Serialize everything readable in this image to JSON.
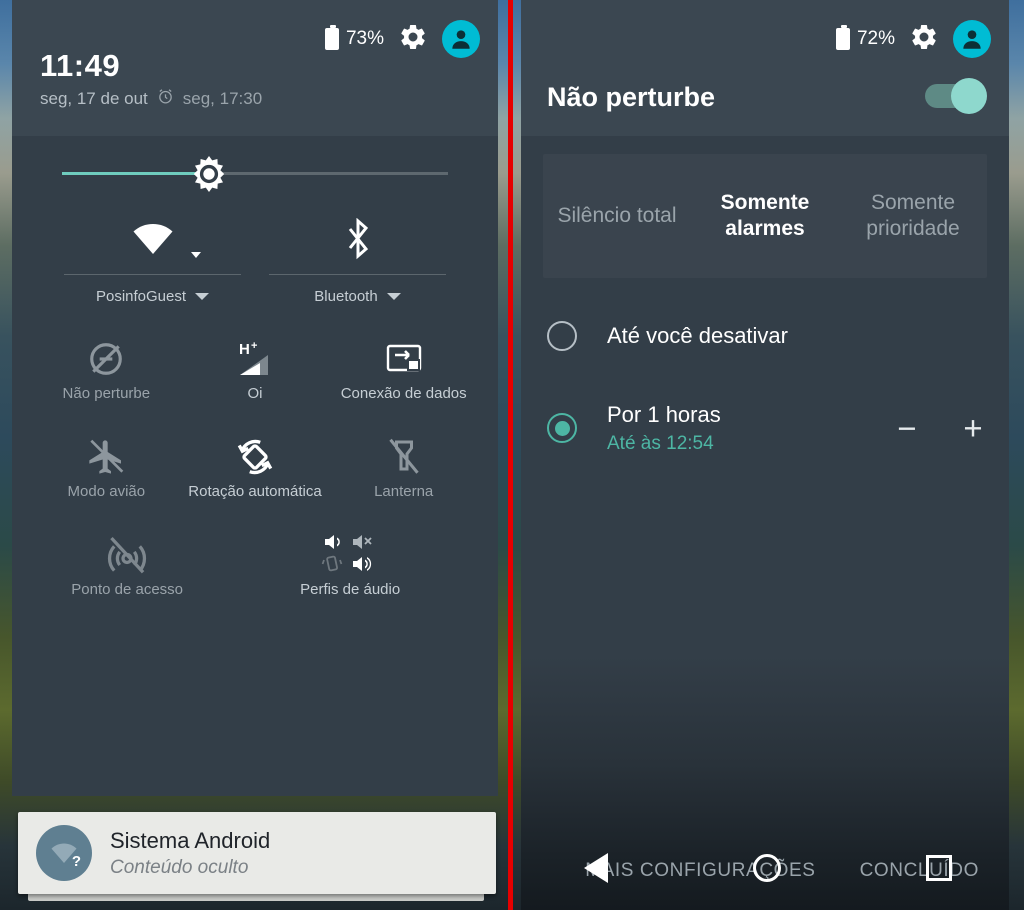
{
  "theme": {
    "panel_bg": "#333e48",
    "header_bg": "#3b4751",
    "accent_teal": "#4db6a4",
    "avatar_cyan": "#00bcd4",
    "divider_red": "#e60000",
    "label_gray": "#c6ced4"
  },
  "left_panel": {
    "status": {
      "battery_percent": "73%",
      "battery_icon": "battery-icon",
      "settings_icon": "gear-icon",
      "avatar_icon": "user-avatar-icon"
    },
    "clock": "11:49",
    "date": "seg, 17 de out",
    "alarm_icon": "alarm-clock-icon",
    "alarm_time": "seg, 17:30",
    "brightness": {
      "icon": "brightness-sun-icon",
      "value_percent": 38
    },
    "top_tiles": [
      {
        "icon": "wifi-icon",
        "label": "PosinfoGuest",
        "has_caret": true,
        "active": true
      },
      {
        "icon": "bluetooth-icon",
        "label": "Bluetooth",
        "has_caret": true,
        "active": true
      }
    ],
    "tiles": [
      {
        "icon": "do-not-disturb-off-icon",
        "label": "Não perturbe",
        "active": false
      },
      {
        "icon": "signal-hplus-icon",
        "label": "Oi",
        "active": true
      },
      {
        "icon": "data-connection-icon",
        "label": "Conexão de dados",
        "active": true
      },
      {
        "icon": "airplane-mode-icon",
        "label": "Modo avião",
        "active": false
      },
      {
        "icon": "auto-rotate-icon",
        "label": "Rotação automática",
        "active": true
      },
      {
        "icon": "flashlight-off-icon",
        "label": "Lanterna",
        "active": false
      },
      {
        "icon": "hotspot-off-icon",
        "label": "Ponto de acesso",
        "active": false
      },
      {
        "icon": "audio-profiles-icon",
        "label": "Perfis de áudio",
        "active": true
      }
    ],
    "notification": {
      "avatar_icon": "wifi-question-icon",
      "badge": "?",
      "title": "Sistema Android",
      "subtitle": "Conteúdo oculto"
    }
  },
  "right_panel": {
    "status": {
      "battery_percent": "72%",
      "battery_icon": "battery-icon",
      "settings_icon": "gear-icon",
      "avatar_icon": "user-avatar-icon"
    },
    "title": "Não perturbe",
    "toggle_on": true,
    "tabs": [
      {
        "label": "Silêncio total",
        "selected": false
      },
      {
        "label": "Somente alarmes",
        "selected": true
      },
      {
        "label": "Somente prioridade",
        "selected": false
      }
    ],
    "options": [
      {
        "label": "Até você desativar",
        "selected": false,
        "subtitle": ""
      },
      {
        "label": "Por 1 horas",
        "selected": true,
        "subtitle": "Até às 12:54"
      }
    ],
    "stepper": {
      "minus": "−",
      "plus": "+"
    },
    "actions": [
      {
        "label": "MAIS CONFIGURAÇÕES"
      },
      {
        "label": "CONCLUÍDO"
      }
    ]
  },
  "navbar": {
    "back_icon": "nav-back-icon",
    "home_icon": "nav-home-icon",
    "recents_icon": "nav-recents-icon"
  }
}
